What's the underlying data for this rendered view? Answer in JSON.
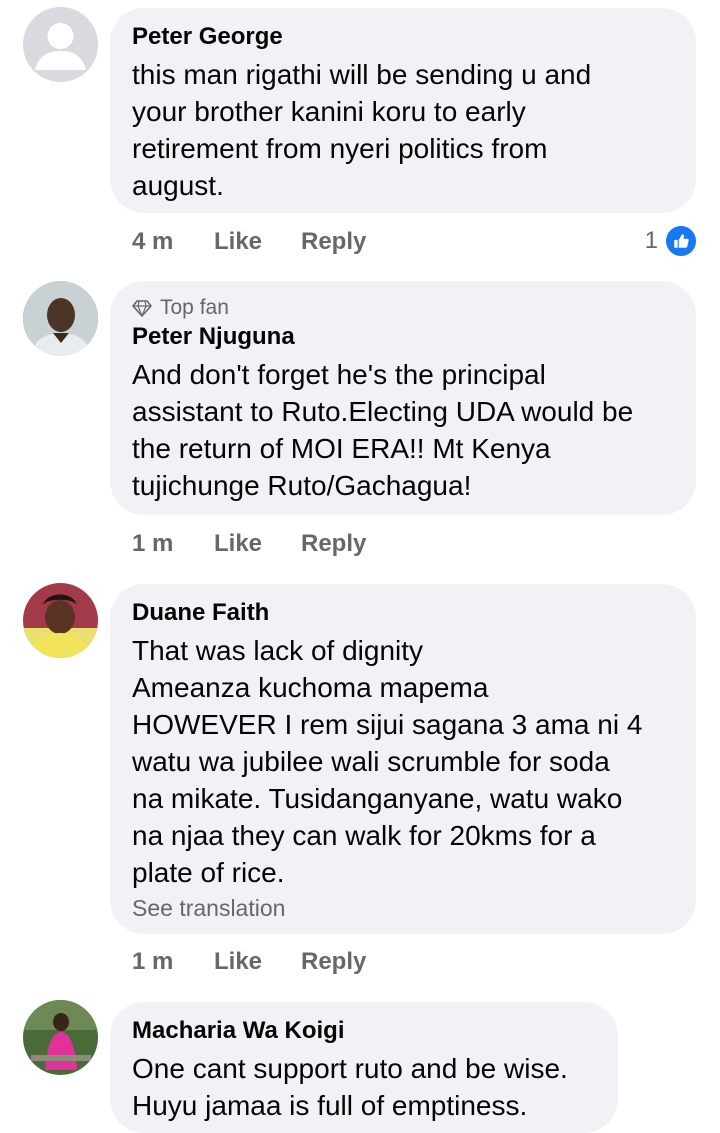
{
  "comments": [
    {
      "name": "Peter George",
      "badge": "",
      "text": "this man rigathi will be sending u and\nyour brother kanini koru to early\nretirement from nyeri politics from\naugust.",
      "see_translation": "",
      "time": "4 m",
      "like_label": "Like",
      "reply_label": "Reply",
      "reaction_count": "1",
      "avatar": "default-avatar-icon"
    },
    {
      "name": "Peter Njuguna",
      "badge": "Top fan",
      "text": "And don't forget he's the principal\nassistant to Ruto.Electing UDA would be\nthe return of MOI ERA!! Mt Kenya\ntujichunge Ruto/Gachagua!",
      "see_translation": "",
      "time": "1 m",
      "like_label": "Like",
      "reply_label": "Reply",
      "avatar": "user-photo"
    },
    {
      "name": "Duane Faith",
      "badge": "",
      "text": "That was lack of dignity\nAmeanza kuchoma mapema\nHOWEVER I rem sijui sagana 3 ama ni 4\nwatu wa jubilee  wali scrumble for soda\nna mikate. Tusidanganyane, watu wako\nna njaa they can walk for 20kms for a\nplate of rice.",
      "see_translation": "See translation",
      "time": "1 m",
      "like_label": "Like",
      "reply_label": "Reply",
      "avatar": "user-photo"
    },
    {
      "name": "Macharia Wa Koigi",
      "badge": "",
      "text": "One cant support ruto and be wise.\nHuyu jamaa is full of emptiness.",
      "see_translation": "",
      "avatar": "user-photo"
    }
  ],
  "colors": {
    "bubble": "#f0f2f5",
    "meta": "#65676b",
    "like_blue": "#1877f2"
  }
}
